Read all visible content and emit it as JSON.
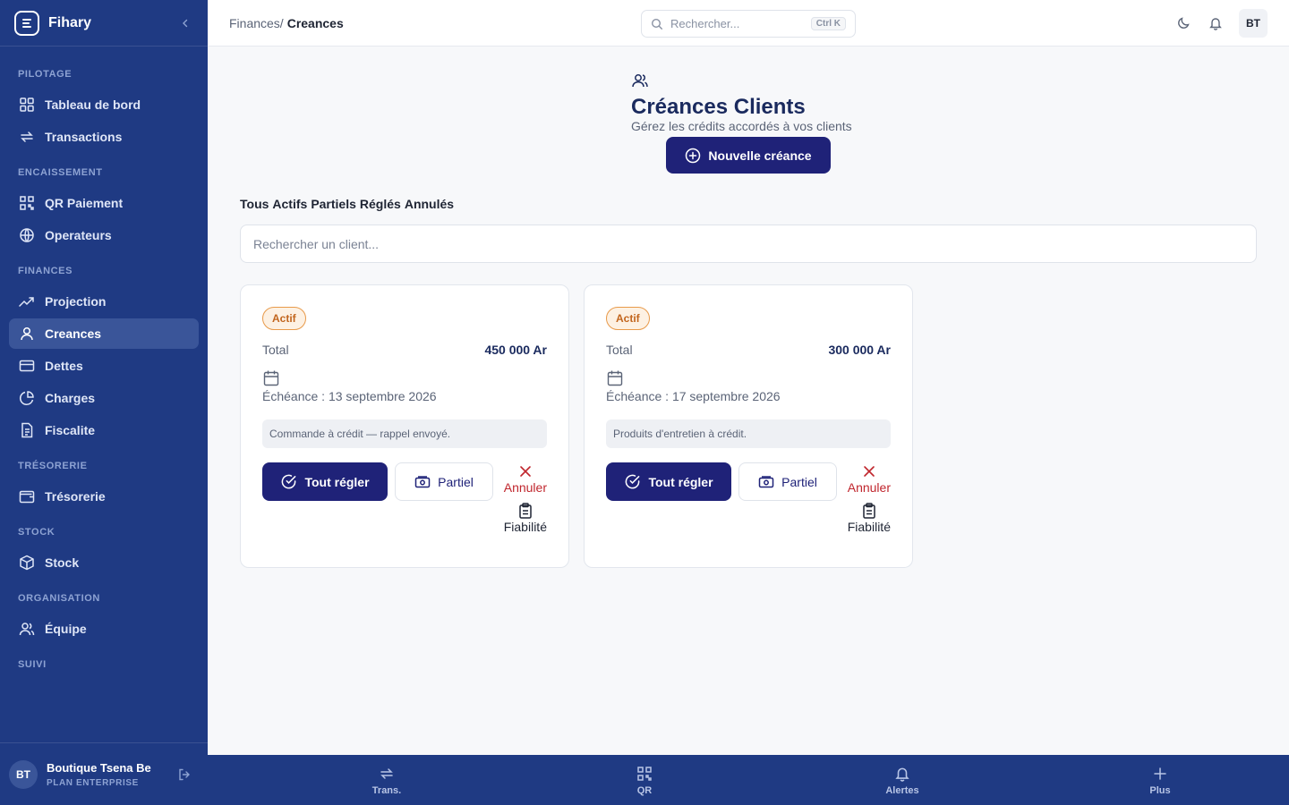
{
  "app": {
    "name": "Fihary"
  },
  "sidebar": {
    "sections": [
      {
        "title": "PILOTAGE",
        "items": [
          {
            "label": "Tableau de bord",
            "icon": "grid-icon"
          },
          {
            "label": "Transactions",
            "icon": "repeat-icon"
          }
        ]
      },
      {
        "title": "ENCAISSEMENT",
        "items": [
          {
            "label": "QR Paiement",
            "icon": "qr-icon"
          },
          {
            "label": "Operateurs",
            "icon": "globe-icon"
          }
        ]
      },
      {
        "title": "FINANCES",
        "items": [
          {
            "label": "Projection",
            "icon": "trend-icon"
          },
          {
            "label": "Creances",
            "icon": "user-icon",
            "active": true
          },
          {
            "label": "Dettes",
            "icon": "card-icon"
          },
          {
            "label": "Charges",
            "icon": "pie-icon"
          },
          {
            "label": "Fiscalite",
            "icon": "file-icon"
          }
        ]
      },
      {
        "title": "TRÉSORERIE",
        "items": [
          {
            "label": "Trésorerie",
            "icon": "wallet-icon"
          }
        ]
      },
      {
        "title": "STOCK",
        "items": [
          {
            "label": "Stock",
            "icon": "box-icon"
          }
        ]
      },
      {
        "title": "ORGANISATION",
        "items": [
          {
            "label": "Équipe",
            "icon": "users-icon"
          }
        ]
      },
      {
        "title": "SUIVI",
        "items": []
      }
    ],
    "user": {
      "initials": "BT",
      "name": "Boutique Tsena Be",
      "plan": "PLAN ENTERPRISE"
    }
  },
  "header": {
    "breadcrumb_parent": "Finances/",
    "breadcrumb_current": "Creances",
    "search_placeholder": "Rechercher...",
    "search_shortcut": "Ctrl K",
    "avatar_initials": "BT"
  },
  "page": {
    "title": "Créances Clients",
    "subtitle": "Gérez les crédits accordés à vos clients",
    "new_button": "Nouvelle créance",
    "filters": [
      "Tous",
      "Actifs",
      "Partiels",
      "Réglés",
      "Annulés"
    ],
    "client_search_placeholder": "Rechercher un client..."
  },
  "cards": [
    {
      "status": "Actif",
      "total_label": "Total",
      "total_value": "450 000 Ar",
      "due": "Échéance : 13 septembre 2026",
      "note": "Commande à crédit — rappel envoyé.",
      "settle_label": "Tout régler",
      "partial_label": "Partiel",
      "cancel_label": "Annuler",
      "reliability_label": "Fiabilité"
    },
    {
      "status": "Actif",
      "total_label": "Total",
      "total_value": "300 000 Ar",
      "due": "Échéance : 17 septembre 2026",
      "note": "Produits d'entretien à crédit.",
      "settle_label": "Tout régler",
      "partial_label": "Partiel",
      "cancel_label": "Annuler",
      "reliability_label": "Fiabilité"
    }
  ],
  "bottom_nav": [
    {
      "label": "Trans.",
      "icon": "repeat-icon"
    },
    {
      "label": "QR",
      "icon": "qr-icon"
    },
    {
      "label": "Alertes",
      "icon": "bell-icon"
    },
    {
      "label": "Plus",
      "icon": "plus-icon"
    }
  ],
  "colors": {
    "sidebar": "#1f3a83",
    "primary": "#1f2278",
    "badge": "#e89a4a",
    "danger": "#c0262d"
  }
}
